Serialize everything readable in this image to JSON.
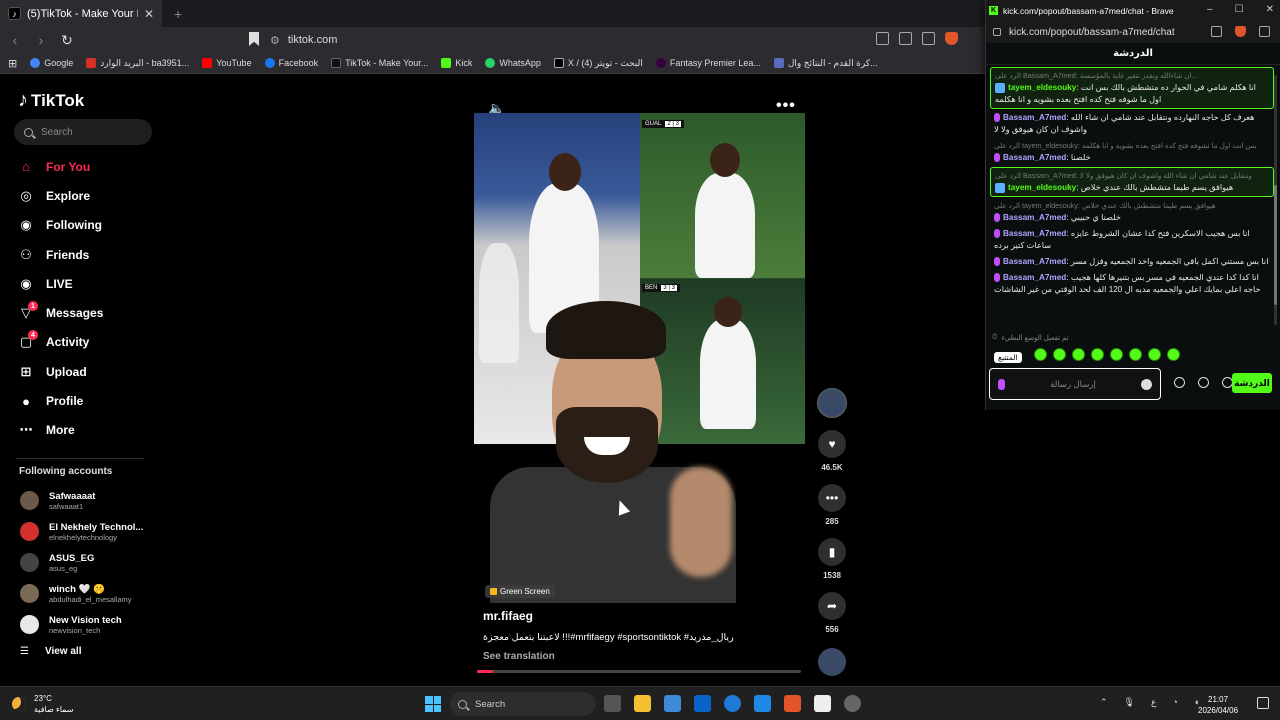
{
  "browser": {
    "tab_title": "(5)TikTok - Make Your Day",
    "url": "tiktok.com",
    "bookmarks": [
      "Google",
      "البريد الوارد - ba3951...",
      "YouTube",
      "Facebook",
      "TikTok - Make Your...",
      "Kick",
      "WhatsApp",
      "X / البحث - تويتر (4)",
      "Fantasy Premier Lea...",
      "كرة القدم - النتائج وال..."
    ]
  },
  "tiktok": {
    "logo": "TikTok",
    "search_placeholder": "Search",
    "nav": [
      {
        "label": "For You",
        "icon": "home-icon",
        "badge": ""
      },
      {
        "label": "Explore",
        "icon": "compass-icon",
        "badge": ""
      },
      {
        "label": "Following",
        "icon": "following-icon",
        "badge": ""
      },
      {
        "label": "Friends",
        "icon": "friends-icon",
        "badge": ""
      },
      {
        "label": "LIVE",
        "icon": "live-icon",
        "badge": ""
      },
      {
        "label": "Messages",
        "icon": "messages-icon",
        "badge": "1"
      },
      {
        "label": "Activity",
        "icon": "activity-icon",
        "badge": "4"
      },
      {
        "label": "Upload",
        "icon": "upload-icon",
        "badge": ""
      },
      {
        "label": "Profile",
        "icon": "profile-icon",
        "badge": ""
      },
      {
        "label": "More",
        "icon": "more-icon",
        "badge": ""
      }
    ],
    "following_title": "Following accounts",
    "accounts": [
      {
        "name": "Safwaaaat",
        "handle": "safwaaat1",
        "color": "#6b5a4a"
      },
      {
        "name": "El Nekhely Technol...",
        "handle": "elnekhelytechnology",
        "color": "#d32f2f"
      },
      {
        "name": "ASUS_EG",
        "handle": "asus_eg",
        "color": "#444444"
      },
      {
        "name": "winch 🤍 🤫",
        "handle": "abdulhadi_el_mesallamy",
        "color": "#7a6a55"
      },
      {
        "name": "New Vision tech",
        "handle": "newvision_tech",
        "color": "#e8e8e8"
      }
    ],
    "view_all": "View all",
    "video": {
      "author": "mr.fifaeg",
      "caption": "ريال_مدريد# mrfifaegy #sportsontiktok#!!! لاعبتنا بتعمل معجزة",
      "see_translation": "See translation",
      "green_screen": "Green Screen",
      "score_1": "GUAL",
      "score_2": "BEN",
      "progress": 0.05
    },
    "actions": {
      "likes": "46.5K",
      "comments": "285",
      "saves": "1538",
      "shares": "556"
    }
  },
  "kick": {
    "window_title": "kick.com/popout/bassam-a7med/chat - Brave",
    "url": "kick.com/popout/bassam-a7med/chat",
    "chat_header": "الدردشة",
    "messages": [
      {
        "reply": "الرد على Bassam_A7med: ان شاءالله ونقدر نتغير غاية بالمؤسسة...",
        "user": "tayem_eldesouky",
        "text": "انا هكلم شامي في الحوار ده متشطش بالك بس انت اول ما شوفه فتح كده افتح بعده بشويه و انا هكلمه",
        "hl": true,
        "icon": "box"
      },
      {
        "reply": "",
        "user": "Bassam_A7med",
        "text": "هعرف كل حاجه النهارده ونتقابل عند شامي ان شاء الله واشوف ان كان هيوفق ولا لا",
        "hl": false,
        "icon": "mic"
      },
      {
        "reply": "الرد على tayem_eldesouky: بس انت اول ما تشوفه فتح كده افتح بعده بشويه و انا هكلمه",
        "user": "Bassam_A7med",
        "text": "خلصنا",
        "hl": false,
        "icon": "mic"
      },
      {
        "reply": "الرد على Bassam_A7med: ونتقابل عند شامي ان شاء الله واشوف ان كان هيوفق ولا لا",
        "user": "tayem_eldesouky",
        "text": "هيوافق يسم طيما متشطش بالك عندي خلاص",
        "hl": true,
        "icon": "box"
      },
      {
        "reply": "الرد على tayem_eldesouky: هيوافق يسم طيما متشطش بالك عندي خلاص",
        "user": "Bassam_A7med",
        "text": "خلصنا ي حبيبي",
        "hl": false,
        "icon": "mic"
      },
      {
        "reply": "",
        "user": "Bassam_A7med",
        "text": "انا بس هجيب الاسكرين فتح كدا عشان الشروط عايزه ساعات كتير برده",
        "hl": false,
        "icon": "mic"
      },
      {
        "reply": "",
        "user": "Bassam_A7med",
        "text": "انا بس مستني اكمل باقي الجمعيه واخد الجمعيه وفزل مسر",
        "hl": false,
        "icon": "mic"
      },
      {
        "reply": "",
        "user": "Bassam_A7med",
        "text": "انا كدا كدا عندي الجمعيه في مسر بس بتنيرها كلها هجيب حاجه اعلي بمايك اعلي والجمعيه مديه ال 120 الف لحد الوقتي من غير الشاشات",
        "hl": false,
        "icon": "mic"
      }
    ],
    "slow_mode": "تم تفعيل الوضع البطيء",
    "tooltip": "المتتبع",
    "input_placeholder": "إرسال رسالة",
    "send_label": "الدردشة"
  },
  "taskbar": {
    "temp": "23°C",
    "weather": "سماء صافية",
    "search": "Search",
    "lang": "ع",
    "time": "21:07",
    "date": "2026/04/06"
  }
}
